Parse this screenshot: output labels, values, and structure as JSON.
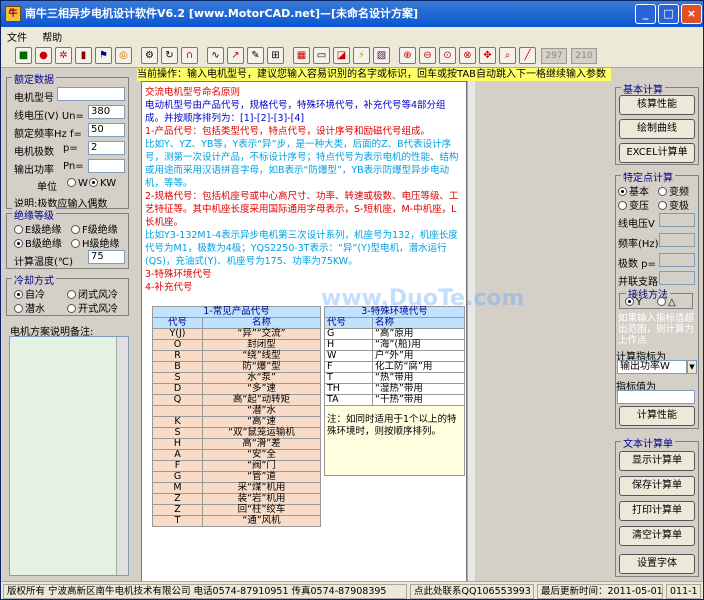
{
  "window": {
    "title": "南牛三相异步电机设计软件V6.2  [www.MotorCAD.net]—[未命名设计方案]",
    "minimize": "_",
    "maximize": "□",
    "close": "×"
  },
  "menu": [
    "文件",
    "帮助"
  ],
  "toolbar": {
    "icons": [
      "save-icon",
      "stop-icon",
      "gear-icon",
      "book-icon",
      "flag-icon",
      "target-icon",
      "motor-icon",
      "cycle-icon",
      "magnet-icon",
      "wave-icon",
      "chart-icon",
      "pen-icon",
      "ruler-icon",
      "panel-icon",
      "display-icon",
      "graph-icon",
      "lightning-icon",
      "spectrum-icon",
      "zoom-in-icon",
      "zoom-out-icon",
      "zoom-fit-icon",
      "zoom-reset-icon",
      "move-icon",
      "search-icon",
      "brush-icon"
    ],
    "input1": "297",
    "input2": "210"
  },
  "status_hint": "当前操作：输入电机型号，建议您输入容易识别的名字或标识，回车或按TAB自动跳入下一格继续输入参数",
  "rated": {
    "title": "额定数据",
    "model_label": "电机型号",
    "model_value": "",
    "voltage_label": "线电压(V) Un=",
    "voltage_value": "380",
    "freq_label": "额定频率Hz f=",
    "freq_value": "50",
    "poles_label": "电机极数",
    "poles_p": "p=",
    "poles_value": "2",
    "power_label": "输出功率",
    "power_pn": "Pn=",
    "power_value": "",
    "unit_label": "单位",
    "unit_w": "W",
    "unit_kw": "KW",
    "note": "说明:极数应输入偶数"
  },
  "insulation": {
    "title": "绝缘等级",
    "e": "E级绝缘",
    "f": "F级绝缘",
    "b": "B级绝缘",
    "h": "H级绝缘",
    "temp_label": "计算温度(℃)",
    "temp_value": "75"
  },
  "cooling": {
    "title": "冷却方式",
    "self": "自冷",
    "closed": "闭式风冷",
    "submerged": "潜水",
    "open": "开式风冷"
  },
  "notes_label": "电机方案说明备注:",
  "doc": {
    "heading": "交流电机型号命名原则",
    "p1": "电动机型号由产品代号，规格代号，特殊环境代号，补充代号等4部分组成。并按顺序排列为：[1]-[2]-[3]-[4]",
    "p2": "1-产品代号：包括类型代号，特点代号，设计序号和励磁代号组成。",
    "p3": "比如Y、YZ、YB等，Y表示“异”步，是一种大类，后面的Z、B代表设计序号，测第一次设计产品，不标设计序号；特点代号为表示电机的性能、结构或用途而采用汉语拼音字母，如B表示“防爆型”，YB表示防爆型异步电动机，等等。",
    "p4": "2-规格代号：包括机座号或中心高尺寸、功率、转速或极数、电压等级、工艺特征等。其中机座长度采用国际通用字母表示，S-短机座，M-中机座，L长机座。",
    "p5": "比如Y3-132M1-4表示异步电机第三次设计系列，机座号为132，机座长度代号为M1，极数为4极；YQS2250-3T表示：“异”(Y)型电机，潜水运行(QS)，充油式(Y)、机座号为175、功率为75KW。",
    "p6": "3-特殊环境代号",
    "p7": "4-补充代号"
  },
  "tableA": {
    "title": "1-常见产品代号",
    "col1": "代号",
    "col2": "名称",
    "rows": [
      [
        "Y(J)",
        "“异”“交流”"
      ],
      [
        "O",
        "封闭型"
      ],
      [
        "R",
        "“绕”线型"
      ],
      [
        "B",
        "防“爆”型"
      ],
      [
        "S",
        "水“泵”"
      ],
      [
        "D",
        "“多”速"
      ],
      [
        "Q",
        "高“起”动转矩"
      ],
      [
        "",
        "“潜”水"
      ],
      [
        "K",
        "“高”速"
      ],
      [
        "S",
        "“双”鼠笼运输机"
      ],
      [
        "H",
        "高“滑”差"
      ],
      [
        "A",
        "“安”全"
      ],
      [
        "F",
        "“阀”门"
      ],
      [
        "G",
        "“管”道"
      ],
      [
        "M",
        "采“煤”机用"
      ],
      [
        "Z",
        "装“岩”机用"
      ],
      [
        "Z",
        "回“柱”绞车"
      ],
      [
        "T",
        "“通”风机"
      ]
    ]
  },
  "tableB": {
    "title": "3-特殊环境代号",
    "col1": "代号",
    "col2": "名称",
    "rows": [
      [
        "G",
        "“高”原用"
      ],
      [
        "H",
        "“海”(船)用"
      ],
      [
        "W",
        "户“外”用"
      ],
      [
        "F",
        "化工防“腐”用"
      ],
      [
        "T",
        "“热”带用"
      ],
      [
        "TH",
        "“湿热”带用"
      ],
      [
        "TA",
        "“干热”带用"
      ]
    ],
    "note": "注：如同时适用于1个以上的特殊环境时，则按顺序排列。"
  },
  "basic": {
    "title": "基本计算",
    "check": "核算性能",
    "draw": "绘制曲线",
    "excel": "EXCEL计算单"
  },
  "special": {
    "title": "特定点计算",
    "basic": "基本",
    "transform": "变频",
    "change_voltage": "变压",
    "change_poles": "变极",
    "voltage_label": "线电压V",
    "freq_label": "频率(Hz)",
    "poles_label": "极数 p=",
    "parallel_label": "并联支路",
    "winding_title": "接线方法",
    "y": "Y",
    "delta": "△",
    "hint": "如果输入指标值超出范围，则计算为上作点",
    "target_label": "计算指标为",
    "target_value": "输出功率W",
    "target_value_label": "指标值为",
    "calc_btn": "计算性能"
  },
  "textcalc": {
    "title": "文本计算单",
    "show": "显示计算单",
    "save": "保存计算单",
    "print": "打印计算单",
    "clear": "清空计算单",
    "font": "设置字体"
  },
  "status": {
    "copyright": "版权所有 宁波高新区南牛电机技术有限公司 电话0574-87910951 传真0574-87908395",
    "contact": "点此处联系QQ106553993",
    "updated": "最后更新时间：2011-05-01",
    "version": "011-1"
  },
  "watermark": "www.DuoTe.com"
}
